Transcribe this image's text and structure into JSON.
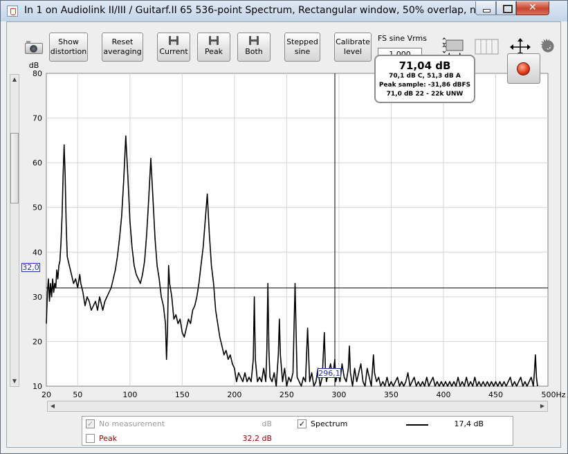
{
  "window": {
    "title": "In 1 on Audiolink II/III / Guitarf.II 65 536-point Spectrum, Rectangular window, 50% overlap, no av..."
  },
  "toolbar": {
    "show_distortion": "Show\ndistortion",
    "reset_averaging": "Reset\naveraging",
    "current": "Current",
    "peak": "Peak",
    "both": "Both",
    "stepped_sine": "Stepped\nsine",
    "calibrate_level": "Calibrate\nlevel",
    "fs_sine_label": "FS sine Vrms",
    "fs_sine_value": "1,000"
  },
  "readout": {
    "main": "71,04 dB",
    "line1": "70,1 dB C, 51,3 dB A",
    "line2": "Peak sample: -31,86 dBFS",
    "line3": "71,0 dB 22 - 22k UNW"
  },
  "cursor": {
    "y_label": "32,0",
    "x_label": "296,1",
    "x_value": 296.1,
    "y_value": 32.0
  },
  "legend": {
    "rows": [
      {
        "label": "No measurement",
        "unit": "dB",
        "checked": true,
        "disabled": true
      },
      {
        "label": "Peak",
        "value": "32,2 dB",
        "checked": false,
        "color": "#a00000"
      }
    ],
    "spectrum": {
      "label": "Spectrum",
      "value": "17,4 dB",
      "checked": true
    }
  },
  "chart_data": {
    "type": "line",
    "ylabel": "dB",
    "xunit": "Hz",
    "xlim": [
      20,
      500
    ],
    "ylim": [
      10,
      80
    ],
    "x_ticks": [
      "20",
      "50",
      "100",
      "150",
      "200",
      "250",
      "300",
      "350",
      "400",
      "450",
      "500Hz"
    ],
    "x_tick_values": [
      20,
      50,
      100,
      150,
      200,
      250,
      300,
      350,
      400,
      450,
      500
    ],
    "y_ticks": [
      "80",
      "70",
      "60",
      "50",
      "40",
      "30",
      "20",
      "10"
    ],
    "y_tick_values": [
      80,
      70,
      60,
      50,
      40,
      30,
      20,
      10
    ],
    "grid": true,
    "series": [
      {
        "name": "Spectrum",
        "color": "#000000",
        "points": [
          [
            20,
            24
          ],
          [
            21,
            31
          ],
          [
            22,
            34
          ],
          [
            23,
            29
          ],
          [
            24,
            33
          ],
          [
            25,
            30
          ],
          [
            26,
            34
          ],
          [
            27,
            31
          ],
          [
            28,
            33
          ],
          [
            29,
            32
          ],
          [
            30,
            36
          ],
          [
            31,
            34
          ],
          [
            32,
            37
          ],
          [
            33,
            38
          ],
          [
            34,
            42
          ],
          [
            35,
            48
          ],
          [
            36,
            57
          ],
          [
            37,
            64
          ],
          [
            38,
            57
          ],
          [
            39,
            46
          ],
          [
            40,
            39
          ],
          [
            42,
            37
          ],
          [
            44,
            35
          ],
          [
            46,
            33
          ],
          [
            48,
            34
          ],
          [
            50,
            32
          ],
          [
            52,
            35
          ],
          [
            53,
            33
          ],
          [
            55,
            31
          ],
          [
            57,
            28
          ],
          [
            59,
            30
          ],
          [
            61,
            29
          ],
          [
            63,
            27
          ],
          [
            65,
            28
          ],
          [
            67,
            29
          ],
          [
            69,
            27
          ],
          [
            71,
            30
          ],
          [
            72,
            29
          ],
          [
            74,
            27
          ],
          [
            76,
            29
          ],
          [
            78,
            30
          ],
          [
            80,
            31
          ],
          [
            82,
            32
          ],
          [
            84,
            34
          ],
          [
            86,
            36
          ],
          [
            88,
            39
          ],
          [
            90,
            43
          ],
          [
            92,
            48
          ],
          [
            94,
            56
          ],
          [
            96,
            66
          ],
          [
            98,
            57
          ],
          [
            100,
            47
          ],
          [
            102,
            41
          ],
          [
            104,
            37
          ],
          [
            106,
            35
          ],
          [
            108,
            34
          ],
          [
            110,
            33
          ],
          [
            112,
            35
          ],
          [
            114,
            38
          ],
          [
            116,
            44
          ],
          [
            118,
            52
          ],
          [
            120,
            61
          ],
          [
            122,
            52
          ],
          [
            124,
            43
          ],
          [
            126,
            37
          ],
          [
            128,
            34
          ],
          [
            130,
            30
          ],
          [
            132,
            28
          ],
          [
            134,
            24
          ],
          [
            135,
            16
          ],
          [
            136,
            23
          ],
          [
            137,
            37
          ],
          [
            138,
            33
          ],
          [
            140,
            30
          ],
          [
            142,
            25
          ],
          [
            144,
            26
          ],
          [
            146,
            24
          ],
          [
            148,
            25
          ],
          [
            150,
            22
          ],
          [
            152,
            21
          ],
          [
            154,
            23
          ],
          [
            156,
            25
          ],
          [
            158,
            24
          ],
          [
            160,
            27
          ],
          [
            162,
            28
          ],
          [
            164,
            30
          ],
          [
            166,
            33
          ],
          [
            168,
            37
          ],
          [
            170,
            41
          ],
          [
            172,
            47
          ],
          [
            174,
            53
          ],
          [
            176,
            44
          ],
          [
            178,
            37
          ],
          [
            180,
            33
          ],
          [
            182,
            27
          ],
          [
            184,
            24
          ],
          [
            186,
            21
          ],
          [
            188,
            19
          ],
          [
            190,
            17
          ],
          [
            192,
            18
          ],
          [
            194,
            16
          ],
          [
            196,
            17
          ],
          [
            198,
            15
          ],
          [
            200,
            14
          ],
          [
            202,
            11
          ],
          [
            204,
            13
          ],
          [
            206,
            12
          ],
          [
            208,
            11
          ],
          [
            210,
            13
          ],
          [
            212,
            11
          ],
          [
            214,
            12
          ],
          [
            216,
            11
          ],
          [
            218,
            16
          ],
          [
            219,
            30
          ],
          [
            220,
            16
          ],
          [
            222,
            11
          ],
          [
            224,
            12
          ],
          [
            226,
            11
          ],
          [
            228,
            14
          ],
          [
            230,
            11
          ],
          [
            231,
            18
          ],
          [
            232,
            33
          ],
          [
            233,
            18
          ],
          [
            234,
            12
          ],
          [
            236,
            11
          ],
          [
            238,
            13
          ],
          [
            240,
            10
          ],
          [
            242,
            17
          ],
          [
            243,
            25
          ],
          [
            244,
            17
          ],
          [
            246,
            11
          ],
          [
            248,
            14
          ],
          [
            250,
            10
          ],
          [
            252,
            12
          ],
          [
            254,
            11
          ],
          [
            256,
            13
          ],
          [
            257,
            23
          ],
          [
            258,
            33
          ],
          [
            259,
            22
          ],
          [
            260,
            12
          ],
          [
            262,
            11
          ],
          [
            264,
            10
          ],
          [
            266,
            12
          ],
          [
            268,
            11
          ],
          [
            270,
            23
          ],
          [
            271,
            17
          ],
          [
            272,
            11
          ],
          [
            274,
            13
          ],
          [
            276,
            10
          ],
          [
            278,
            11
          ],
          [
            280,
            14
          ],
          [
            282,
            10
          ],
          [
            284,
            12
          ],
          [
            286,
            22
          ],
          [
            287,
            14
          ],
          [
            288,
            11
          ],
          [
            290,
            13
          ],
          [
            292,
            15
          ],
          [
            294,
            12
          ],
          [
            296,
            16
          ],
          [
            297,
            11
          ],
          [
            299,
            13
          ],
          [
            301,
            11
          ],
          [
            303,
            15
          ],
          [
            305,
            12
          ],
          [
            307,
            11
          ],
          [
            309,
            14
          ],
          [
            310,
            19
          ],
          [
            311,
            13
          ],
          [
            313,
            10
          ],
          [
            315,
            14
          ],
          [
            317,
            11
          ],
          [
            319,
            13
          ],
          [
            321,
            15
          ],
          [
            323,
            11
          ],
          [
            325,
            10
          ],
          [
            327,
            14
          ],
          [
            329,
            12
          ],
          [
            331,
            10
          ],
          [
            333,
            17
          ],
          [
            334,
            13
          ],
          [
            336,
            11
          ],
          [
            338,
            12
          ],
          [
            340,
            10
          ],
          [
            342,
            11
          ],
          [
            344,
            10
          ],
          [
            346,
            12
          ],
          [
            348,
            10
          ],
          [
            350,
            11
          ],
          [
            352,
            10
          ],
          [
            354,
            11
          ],
          [
            356,
            12
          ],
          [
            358,
            10
          ],
          [
            360,
            11
          ],
          [
            362,
            10
          ],
          [
            364,
            11
          ],
          [
            366,
            13
          ],
          [
            368,
            10
          ],
          [
            370,
            11
          ],
          [
            372,
            12
          ],
          [
            374,
            10
          ],
          [
            376,
            11
          ],
          [
            378,
            10
          ],
          [
            380,
            11
          ],
          [
            382,
            10
          ],
          [
            384,
            12
          ],
          [
            386,
            10
          ],
          [
            388,
            11
          ],
          [
            390,
            12
          ],
          [
            392,
            10
          ],
          [
            394,
            11
          ],
          [
            396,
            10
          ],
          [
            398,
            11
          ],
          [
            400,
            10
          ],
          [
            402,
            11
          ],
          [
            404,
            10
          ],
          [
            406,
            11
          ],
          [
            408,
            10
          ],
          [
            410,
            11
          ],
          [
            412,
            10
          ],
          [
            414,
            12
          ],
          [
            416,
            10
          ],
          [
            418,
            11
          ],
          [
            420,
            10
          ],
          [
            422,
            12
          ],
          [
            424,
            10
          ],
          [
            426,
            11
          ],
          [
            428,
            10
          ],
          [
            430,
            12
          ],
          [
            432,
            10
          ],
          [
            434,
            11
          ],
          [
            436,
            10
          ],
          [
            438,
            11
          ],
          [
            440,
            10
          ],
          [
            442,
            11
          ],
          [
            444,
            10
          ],
          [
            446,
            11
          ],
          [
            448,
            10
          ],
          [
            450,
            11
          ],
          [
            452,
            10
          ],
          [
            454,
            11
          ],
          [
            456,
            10
          ],
          [
            458,
            11
          ],
          [
            460,
            10
          ],
          [
            462,
            11
          ],
          [
            464,
            12
          ],
          [
            466,
            10
          ],
          [
            468,
            11
          ],
          [
            470,
            10
          ],
          [
            472,
            11
          ],
          [
            474,
            12
          ],
          [
            476,
            10
          ],
          [
            478,
            11
          ],
          [
            480,
            10
          ],
          [
            482,
            11
          ],
          [
            484,
            12
          ],
          [
            486,
            10
          ],
          [
            487,
            13
          ],
          [
            488,
            17
          ],
          [
            489,
            12
          ],
          [
            490,
            10
          ]
        ]
      }
    ]
  }
}
